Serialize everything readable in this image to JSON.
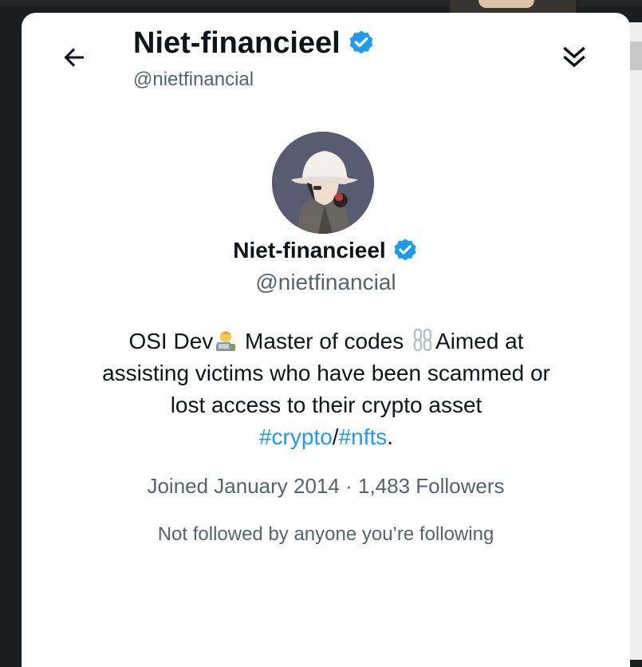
{
  "header": {
    "name": "Niet-financieel",
    "handle": "@nietfinancial"
  },
  "profile": {
    "name": "Niet-financieel",
    "handle": "@nietfinancial",
    "verified": true,
    "bio": {
      "line1_part1": "OSI Dev",
      "line1_part2": " Master of codes ",
      "line1_part3": "Aimed at",
      "line2": "assisting victims who have been scammed or",
      "line3": "lost access to their crypto asset",
      "hashtag1": "#crypto",
      "separator": "/",
      "hashtag2": "#nfts",
      "end": "."
    },
    "joined": "Joined January 2014",
    "dot": "·",
    "followers": "1,483 Followers",
    "followed_by": "Not followed by anyone you’re following"
  },
  "icons": {
    "back": "arrow-left-icon",
    "expand": "chevrons-down-icon",
    "verified": "verified-badge-icon",
    "dev_emoji": "technologist-emoji-icon",
    "chain_emoji": "chain-emoji-icon"
  },
  "colors": {
    "link": "#1d9bf0",
    "text": "#0f1419",
    "secondary": "#536471",
    "verified": "#1d9bf0"
  }
}
